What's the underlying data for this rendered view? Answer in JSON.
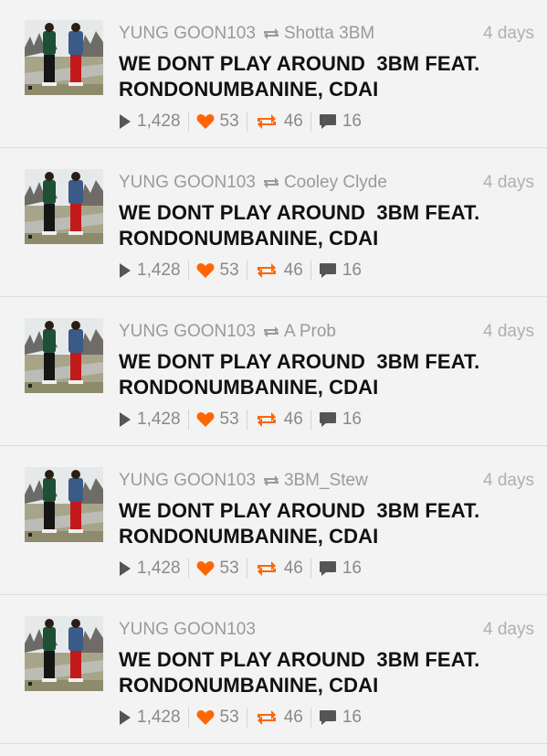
{
  "colors": {
    "accent": "#ff6600",
    "muted": "#9a9a9a",
    "title": "#111111"
  },
  "icons": {
    "play": "play-icon",
    "like": "heart-icon",
    "repost": "repost-icon",
    "comment": "comment-icon"
  },
  "feed": {
    "items": [
      {
        "uploader": "YUNG GOON103",
        "reposter": "Shotta 3BM",
        "time": "4 days",
        "title": "WE DONT PLAY AROUND  3BM FEAT.\nRONDONUMBANINE, CDAI",
        "plays": "1,428",
        "likes": "53",
        "reposts": "46",
        "comments": "16"
      },
      {
        "uploader": "YUNG GOON103",
        "reposter": "Cooley Clyde",
        "time": "4 days",
        "title": "WE DONT PLAY AROUND  3BM FEAT.\nRONDONUMBANINE, CDAI",
        "plays": "1,428",
        "likes": "53",
        "reposts": "46",
        "comments": "16"
      },
      {
        "uploader": "YUNG GOON103",
        "reposter": "A Prob",
        "time": "4 days",
        "title": "WE DONT PLAY AROUND  3BM FEAT.\nRONDONUMBANINE, CDAI",
        "plays": "1,428",
        "likes": "53",
        "reposts": "46",
        "comments": "16"
      },
      {
        "uploader": "YUNG GOON103",
        "reposter": "3BM_Stew",
        "time": "4 days",
        "title": "WE DONT PLAY AROUND  3BM FEAT.\nRONDONUMBANINE, CDAI",
        "plays": "1,428",
        "likes": "53",
        "reposts": "46",
        "comments": "16"
      },
      {
        "uploader": "YUNG GOON103",
        "reposter": "",
        "time": "4 days",
        "title": "WE DONT PLAY AROUND  3BM FEAT.\nRONDONUMBANINE, CDAI",
        "plays": "1,428",
        "likes": "53",
        "reposts": "46",
        "comments": "16"
      }
    ]
  }
}
